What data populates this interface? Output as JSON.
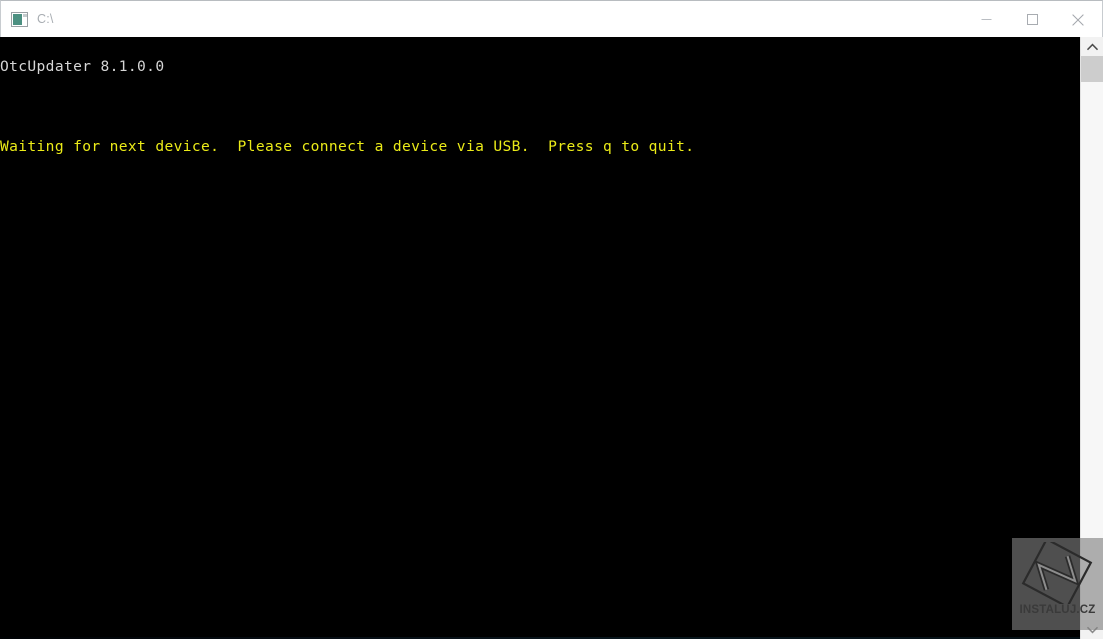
{
  "window": {
    "title": "C:\\",
    "icon": "console-window-icon",
    "controls": [
      {
        "name": "minimize-button",
        "glyph": "minimize-icon",
        "label": "Minimize"
      },
      {
        "name": "maximize-button",
        "glyph": "maximize-icon",
        "label": "Maximize"
      },
      {
        "name": "close-button",
        "glyph": "close-icon",
        "label": "Close"
      }
    ]
  },
  "console": {
    "background_color": "#000000",
    "lines": [
      {
        "text": "OtcUpdater 8.1.0.0",
        "color": "#d6d6d6",
        "style": "line-white"
      },
      {
        "text": "",
        "color": "#000000",
        "style": "line-blank"
      },
      {
        "text": "Waiting for next device.  Please connect a device via USB.  Press q to quit.",
        "color": "#ebeb18",
        "style": "line-yellow"
      }
    ],
    "app_name": "OtcUpdater",
    "app_version": "8.1.0.0",
    "status_message": "Waiting for next device.  Please connect a device via USB.  Press q to quit.",
    "quit_key": "q"
  },
  "scrollbar": {
    "up_arrow": "chevron-up-icon",
    "down_arrow": "chevron-down-icon",
    "thumb_position_percent": 0,
    "orientation": "vertical"
  },
  "watermark": {
    "label": "INSTALUJ.CZ",
    "logo": "instaluj-diamond-n-logo"
  }
}
